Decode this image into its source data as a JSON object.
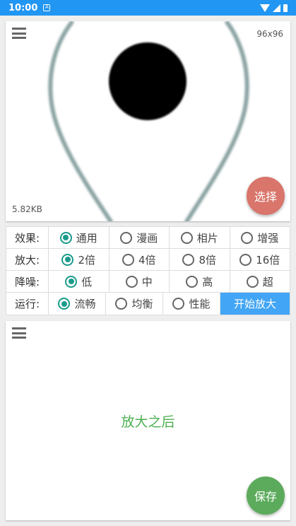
{
  "status_bar": {
    "time": "10:00",
    "notif_glyph": "A"
  },
  "input_panel": {
    "dimensions": "96x96",
    "file_size": "5.82KB",
    "select_label": "选择"
  },
  "options": {
    "effect": {
      "label": "效果:",
      "choices": [
        "通用",
        "漫画",
        "相片",
        "增强"
      ],
      "selected": "通用"
    },
    "scale": {
      "label": "放大:",
      "choices": [
        "2倍",
        "4倍",
        "8倍",
        "16倍"
      ],
      "selected": "2倍"
    },
    "denoise": {
      "label": "降噪:",
      "choices": [
        "低",
        "中",
        "高",
        "超"
      ],
      "selected": "低"
    },
    "run": {
      "label": "运行:",
      "choices": [
        "流畅",
        "均衡",
        "性能"
      ],
      "selected": "流畅",
      "start_label": "开始放大"
    }
  },
  "output_panel": {
    "placeholder": "放大之后",
    "save_label": "保存"
  },
  "colors": {
    "status_bar": "#2196f3",
    "radio_checked": "#1a9b8c",
    "select_fab": "#d9756b",
    "save_fab": "#5cab5c",
    "start_button": "#42a5f5",
    "after_text": "#4caf50"
  }
}
